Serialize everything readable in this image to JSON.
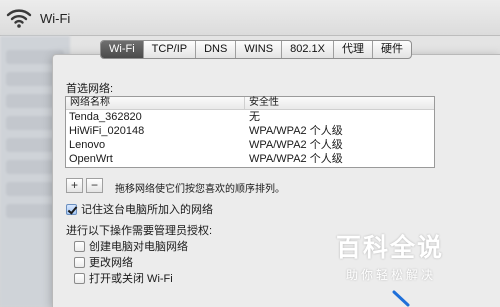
{
  "header": {
    "title": "Wi-Fi"
  },
  "tabs": [
    {
      "label": "Wi-Fi",
      "active": true
    },
    {
      "label": "TCP/IP",
      "active": false
    },
    {
      "label": "DNS",
      "active": false
    },
    {
      "label": "WINS",
      "active": false
    },
    {
      "label": "802.1X",
      "active": false
    },
    {
      "label": "代理",
      "active": false
    },
    {
      "label": "硬件",
      "active": false
    }
  ],
  "preferred": {
    "label": "首选网络:",
    "columns": [
      "网络名称",
      "安全性"
    ],
    "rows": [
      {
        "name": "Tenda_362820",
        "security": "无"
      },
      {
        "name": "HiWiFi_020148",
        "security": "WPA/WPA2 个人级"
      },
      {
        "name": "Lenovo",
        "security": "WPA/WPA2 个人级"
      },
      {
        "name": "OpenWrt",
        "security": "WPA/WPA2 个人级"
      }
    ],
    "add_label": "+",
    "remove_label": "−",
    "hint": "拖移网络使它们按您喜欢的顺序排列。"
  },
  "remember": {
    "label": "记住这台电脑所加入的网络",
    "checked": true
  },
  "admin": {
    "label": "进行以下操作需要管理员授权:",
    "options": [
      {
        "label": "创建电脑对电脑网络",
        "checked": false
      },
      {
        "label": "更改网络",
        "checked": false
      },
      {
        "label": "打开或关闭 Wi-Fi",
        "checked": false
      }
    ]
  },
  "watermark": {
    "title": "百科全说",
    "subtitle": "助你轻松解决"
  }
}
